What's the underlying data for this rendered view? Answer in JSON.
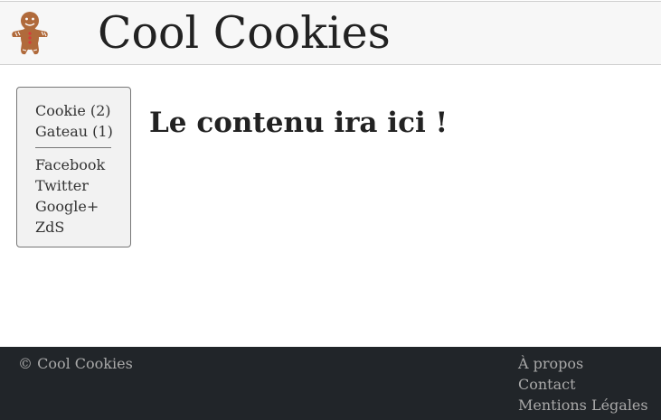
{
  "header": {
    "logo_icon": "gingerbread-man-icon",
    "title": "Cool Cookies"
  },
  "sidebar": {
    "categories": [
      {
        "label": "Cookie (2)"
      },
      {
        "label": "Gateau (1)"
      }
    ],
    "social": [
      {
        "label": "Facebook"
      },
      {
        "label": "Twitter"
      },
      {
        "label": "Google+"
      },
      {
        "label": "ZdS"
      }
    ]
  },
  "main": {
    "heading": "Le contenu ira ici !"
  },
  "footer": {
    "copyright": "© Cool Cookies",
    "links": [
      {
        "label": "À propos"
      },
      {
        "label": "Contact"
      },
      {
        "label": "Mentions Légales"
      }
    ]
  },
  "colors": {
    "header_bg": "#f7f7f7",
    "sidebar_bg": "#f2f2f2",
    "footer_bg": "#212529",
    "footer_text": "#a9a9a9",
    "cookie_brown": "#b06a3b"
  }
}
